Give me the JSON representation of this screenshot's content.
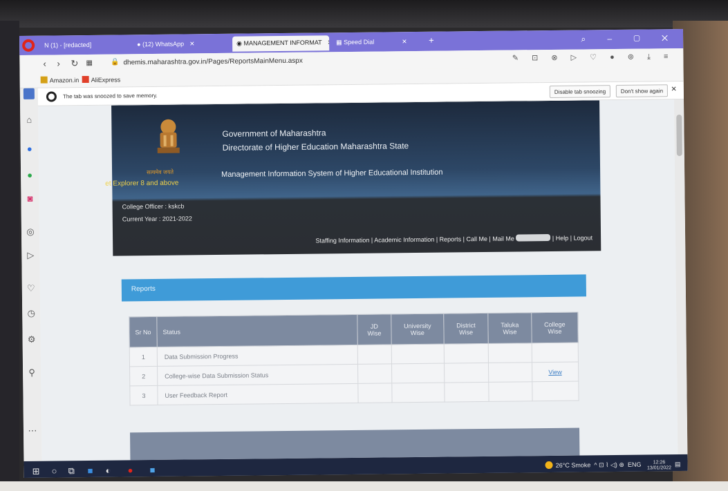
{
  "browser": {
    "tabs": [
      {
        "label": "N (1) - [redacted]",
        "active": false
      },
      {
        "label": "(12) WhatsApp",
        "active": false
      },
      {
        "label": "MANAGEMENT INFORMAT",
        "active": true
      },
      {
        "label": "Speed Dial",
        "active": false
      }
    ],
    "url": "dhemis.maharashtra.gov.in/Pages/ReportsMainMenu.aspx",
    "bookmarks": [
      "Amazon.in",
      "AliExpress"
    ],
    "snooze_message": "The tab was snoozed to save memory.",
    "snooze_disable_label": "Disable tab snoozing",
    "snooze_dont_show_label": "Don't show again"
  },
  "header": {
    "emblem_caption": "सत्यमेव जयते",
    "ie_note": "et Explorer 8 and above",
    "gov_line1": "Government of Maharashtra",
    "gov_line2": "Directorate of Higher Education Maharashtra State",
    "system_name": "Management Information System of Higher Educational Institution",
    "officer": "College Officer : kskcb",
    "year": "Current Year : 2021-2022",
    "nav": [
      "Staffing Information",
      "Academic Information",
      "Reports",
      "Call Me",
      "Mail Me",
      "",
      "Help",
      "Logout"
    ]
  },
  "reports": {
    "title": "Reports",
    "columns": [
      "Sr No",
      "Status",
      "JD Wise",
      "University Wise",
      "District Wise",
      "Taluka Wise",
      "College Wise"
    ],
    "rows": [
      {
        "sr": "1",
        "status": "Data Submission Progress",
        "college": ""
      },
      {
        "sr": "2",
        "status": "College-wise Data Submission Status",
        "college": "View"
      },
      {
        "sr": "3",
        "status": "User Feedback Report",
        "college": ""
      }
    ]
  },
  "taskbar": {
    "weather": "26°C  Smoke",
    "lang": "ENG",
    "time": "12:26",
    "date": "13/01/2022"
  }
}
